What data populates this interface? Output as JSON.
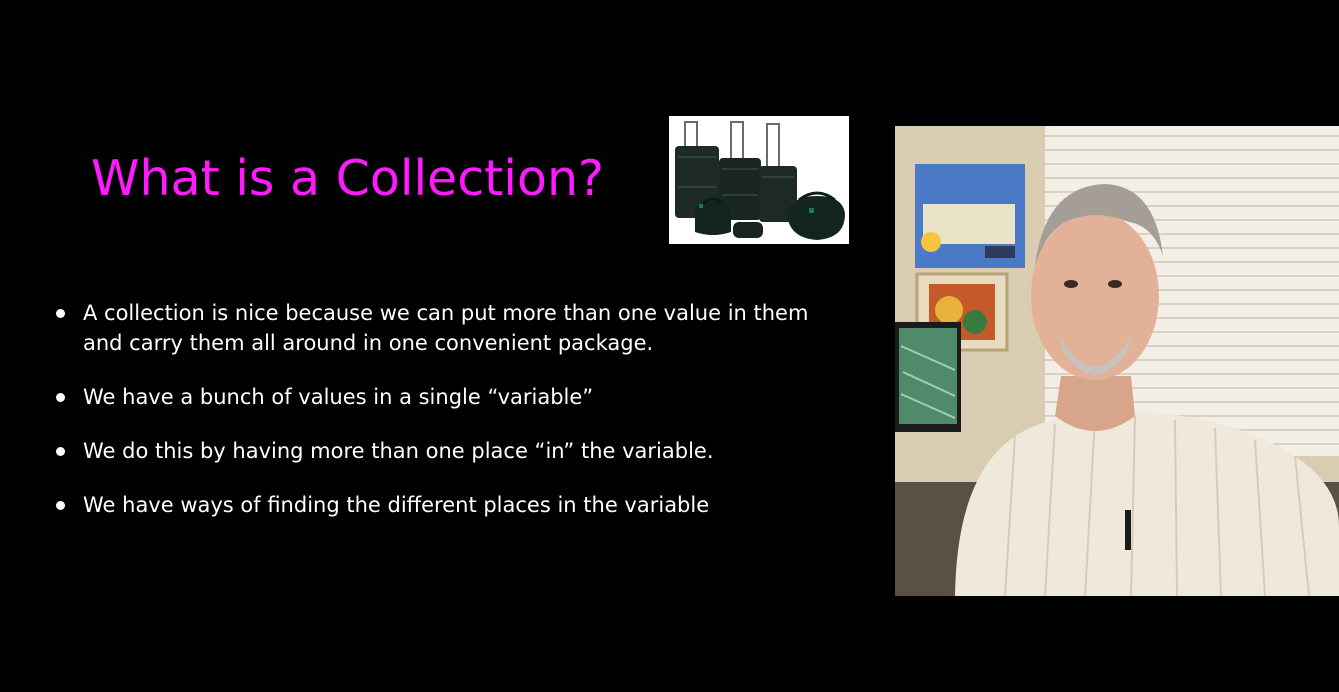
{
  "slide": {
    "title": "What is a Collection?",
    "title_color": "#ff1aff",
    "background_color": "#000000",
    "bullets": [
      "A collection is nice because we can put more than one value in them and carry them all around in one convenient package.",
      "We have a bunch of values in a single “variable”",
      "We do this by having more than one place “in” the variable.",
      "We have ways of finding the different places in the variable"
    ]
  },
  "icons": {
    "luggage": "luggage-set-image",
    "bullet": "bullet-dot-icon",
    "speaker": "speaker-video-feed"
  }
}
